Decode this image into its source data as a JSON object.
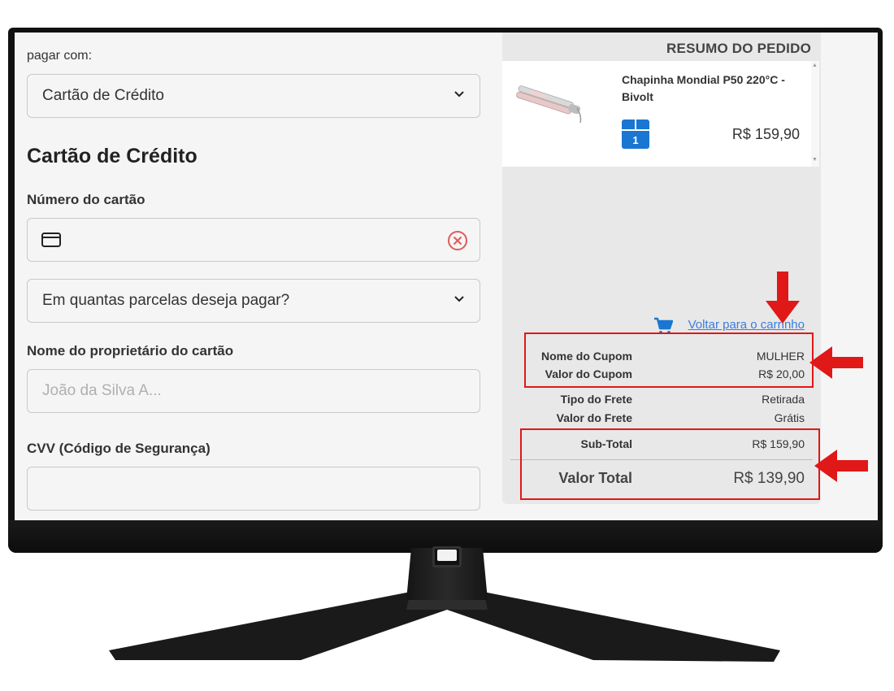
{
  "checkout": {
    "pay_with_label": "pagar com:",
    "payment_method": "Cartão de Crédito",
    "section_title": "Cartão de Crédito",
    "card_number_label": "Número do cartão",
    "card_number_value": "",
    "installments_placeholder": "Em quantas parcelas deseja pagar?",
    "owner_label": "Nome do proprietário do cartão",
    "owner_placeholder": "João da Silva A...",
    "cvv_label": "CVV (Código de Segurança)",
    "cvv_value": ""
  },
  "summary": {
    "title": "RESUMO DO PEDIDO",
    "product": {
      "name": "Chapinha Mondial P50 220°C - Bivolt",
      "quantity": "1",
      "price": "R$ 159,90",
      "image_icon": "hair-straightener-icon"
    },
    "back_link": "Voltar para o carrinho",
    "coupon_name_label": "Nome do Cupom",
    "coupon_name_value": "MULHER",
    "coupon_value_label": "Valor do Cupom",
    "coupon_value_value": "R$ 20,00",
    "shipping_type_label": "Tipo do Frete",
    "shipping_type_value": "Retirada",
    "shipping_value_label": "Valor do Frete",
    "shipping_value_value": "Grátis",
    "subtotal_label": "Sub-Total",
    "subtotal_value": "R$ 159,90",
    "total_label": "Valor Total",
    "total_value": "R$ 139,90"
  },
  "colors": {
    "accent_blue": "#1976d2",
    "link_blue": "#3b7ddd",
    "annotation_red": "#e01818",
    "clear_icon_red": "#e05a5a"
  }
}
